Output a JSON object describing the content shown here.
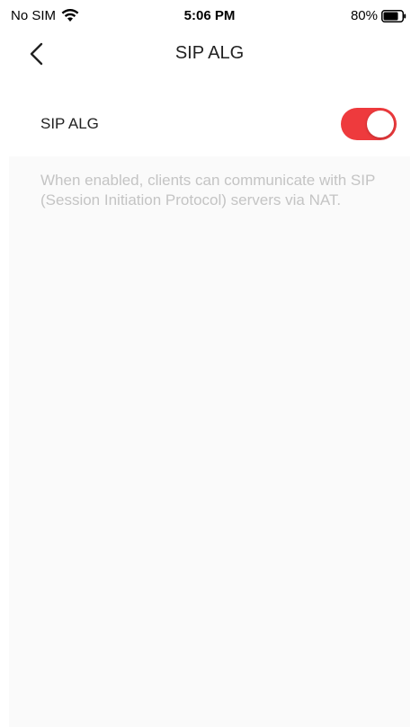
{
  "status_bar": {
    "carrier": "No SIM",
    "time": "5:06 PM",
    "battery": "80%",
    "battery_level": 0.8,
    "wifi_icon": "wifi-icon",
    "battery_icon": "battery-icon"
  },
  "nav": {
    "title": "SIP ALG",
    "back_icon": "chevron-left-icon"
  },
  "setting": {
    "label": "SIP ALG",
    "enabled": true,
    "toggle_color": "#ee3a3d"
  },
  "description": "When enabled, clients can communicate with SIP (Session Initiation Protocol) servers via NAT."
}
